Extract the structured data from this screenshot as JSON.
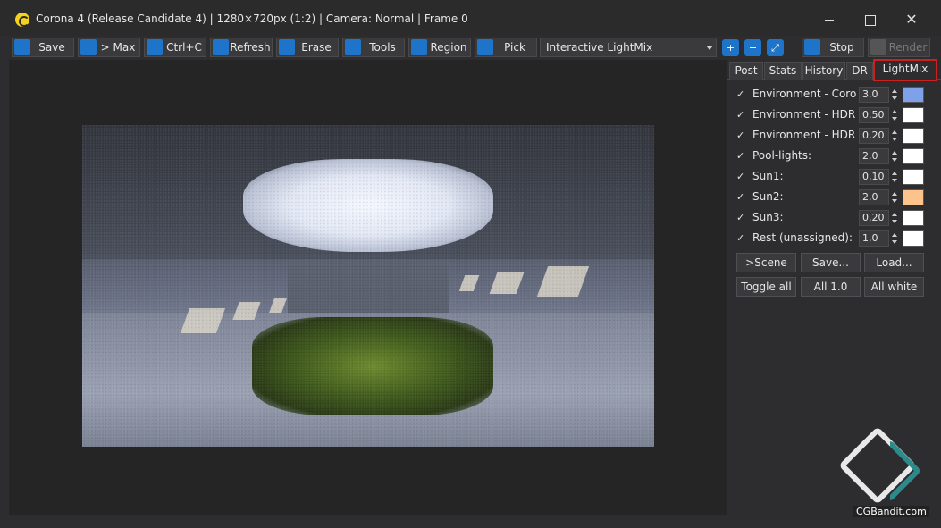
{
  "window": {
    "title": "Corona 4 (Release Candidate 4) | 1280×720px (1:2) | Camera: Normal | Frame 0"
  },
  "toolbar": {
    "save": "Save",
    "max": "> Max",
    "copy": "Ctrl+C",
    "refresh": "Refresh",
    "erase": "Erase",
    "tools": "Tools",
    "region": "Region",
    "pick": "Pick",
    "mode_selected": "Interactive LightMix",
    "stop": "Stop",
    "render": "Render"
  },
  "panel": {
    "tabs": [
      "Post",
      "Stats",
      "History",
      "DR",
      "LightMix"
    ],
    "active_tab": "LightMix",
    "lightmix": [
      {
        "label": "Environment - Corona",
        "value": "3,0",
        "checked": true,
        "color": "#7ea1ea"
      },
      {
        "label": "Environment - HDRI-s",
        "value": "0,50",
        "checked": true,
        "color": "#ffffff"
      },
      {
        "label": "Environment - HDRI-v",
        "value": "0,20",
        "checked": true,
        "color": "#ffffff"
      },
      {
        "label": "Pool-lights:",
        "value": "2,0",
        "checked": true,
        "color": "#ffffff"
      },
      {
        "label": "Sun1:",
        "value": "0,10",
        "checked": true,
        "color": "#ffffff"
      },
      {
        "label": "Sun2:",
        "value": "2,0",
        "checked": true,
        "color": "#fcc38c"
      },
      {
        "label": "Sun3:",
        "value": "0,20",
        "checked": true,
        "color": "#ffffff"
      },
      {
        "label": "Rest (unassigned):",
        "value": "1,0",
        "checked": true,
        "color": "#ffffff"
      }
    ],
    "buttons": {
      "scene": ">Scene",
      "save": "Save...",
      "load": "Load...",
      "toggle_all": "Toggle all",
      "all_one": "All 1.0",
      "all_white": "All white"
    }
  },
  "watermark": {
    "text": "CGBandit.com"
  }
}
